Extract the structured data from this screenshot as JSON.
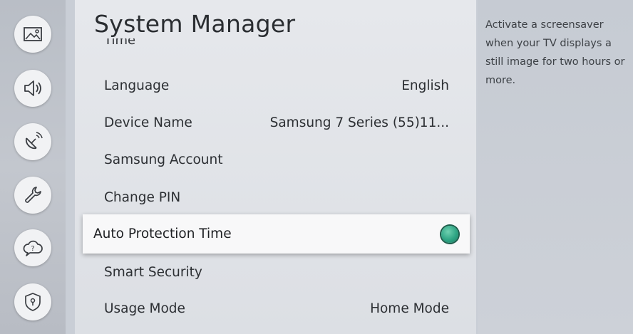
{
  "sidebar": {
    "items": [
      {
        "name": "picture",
        "icon": "picture-icon"
      },
      {
        "name": "sound",
        "icon": "speaker-icon"
      },
      {
        "name": "broadcasting",
        "icon": "satellite-dish-icon"
      },
      {
        "name": "general",
        "icon": "wrench-icon"
      },
      {
        "name": "support",
        "icon": "help-cloud-icon"
      },
      {
        "name": "privacy",
        "icon": "shield-lock-icon"
      }
    ],
    "active": "general"
  },
  "panel": {
    "title": "System Manager",
    "partial_item": "Time",
    "items": [
      {
        "label": "Language",
        "value": "English"
      },
      {
        "label": "Device Name",
        "value": "Samsung 7 Series (55)11..."
      },
      {
        "label": "Samsung Account",
        "value": ""
      },
      {
        "label": "Change PIN",
        "value": ""
      }
    ],
    "selected": {
      "label": "Auto Protection Time",
      "toggle_on": true,
      "toggle_color": "#2ea584"
    },
    "items_after": [
      {
        "label": "Smart Security",
        "value": ""
      },
      {
        "label": "Usage Mode",
        "value": "Home Mode"
      }
    ]
  },
  "description": "Activate a screensaver when your TV displays a still image for two hours or more."
}
